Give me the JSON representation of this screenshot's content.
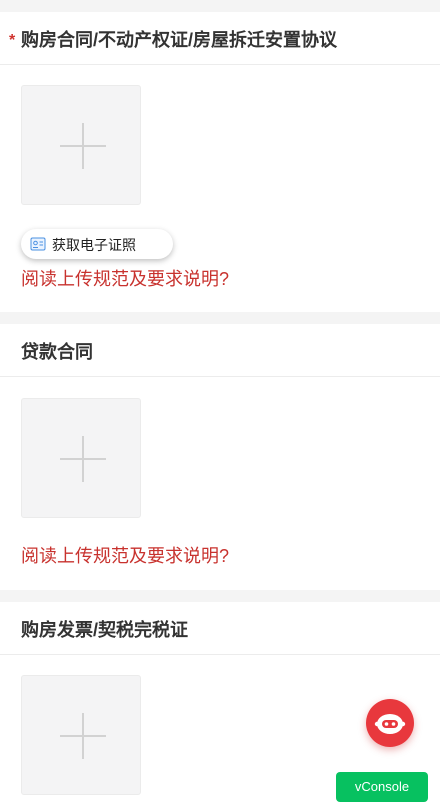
{
  "sections": [
    {
      "title": "购房合同/不动产权证/房屋拆迁安置协议",
      "required_mark": "*",
      "get_cert_label": "获取电子证照",
      "requirements_link": "阅读上传规范及要求说明?"
    },
    {
      "title": "贷款合同",
      "requirements_link": "阅读上传规范及要求说明?"
    },
    {
      "title": "购房发票/契税完税证"
    }
  ],
  "icons": {
    "upload_add": "plus-icon",
    "certificate": "id-card-icon",
    "assistant": "robot-icon"
  },
  "colors": {
    "required": "#d0332e",
    "link": "#c8322e",
    "vconsole": "#07c160",
    "assistant": "#e8383d"
  },
  "vconsole_label": "vConsole"
}
